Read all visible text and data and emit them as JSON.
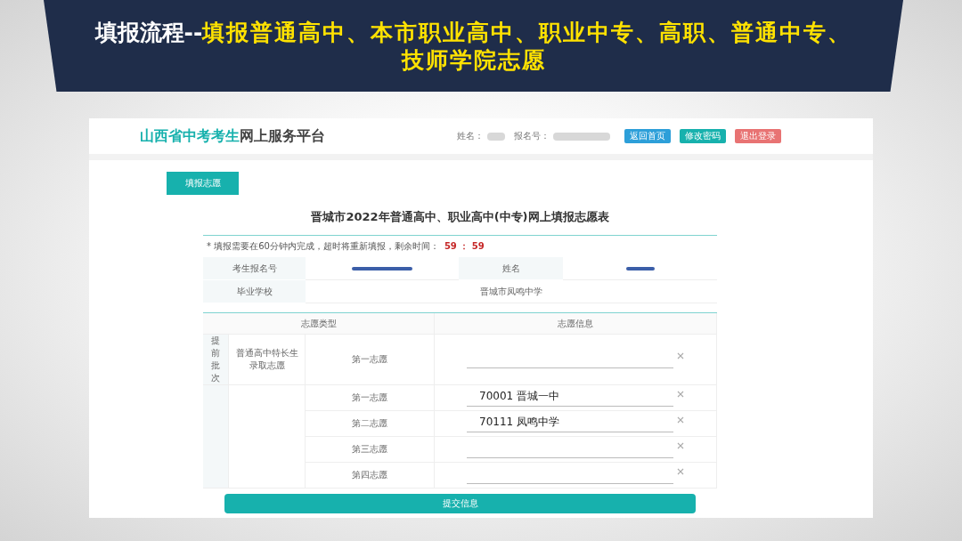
{
  "slide_title": {
    "lead": "填报流程--",
    "rest": "填报普通高中、本市职业高中、职业中专、高职、普通中专、技师学院志愿"
  },
  "header": {
    "brand_highlight": "山西省中考考生",
    "brand_rest": "网上服务平台",
    "name_label": "姓名：",
    "exam_no_label": "报名号：",
    "buttons": [
      {
        "label": "返回首页",
        "kind": "home"
      },
      {
        "label": "修改密码",
        "kind": "password"
      },
      {
        "label": "退出登录",
        "kind": "logout"
      }
    ]
  },
  "tab": {
    "label": "填报志愿",
    "selected": true
  },
  "form_title": "晋城市2022年普通高中、职业高中(中专)网上填报志愿表",
  "notice": {
    "mark": "*",
    "text": "填报需要在60分钟内完成，超时将重新填报，剩余时间：",
    "timer": "59 ： 59"
  },
  "student": [
    {
      "label": "考生报名号",
      "redacted": true
    },
    {
      "label": "姓名",
      "redacted": true
    },
    {
      "label": "毕业学校",
      "value": "晋城市凤鸣中学"
    }
  ],
  "choices": {
    "columns": [
      "志愿类型",
      "志愿信息"
    ],
    "groups": [
      {
        "batch": "提前批次",
        "type": "普通高中特长生录取志愿",
        "rows": [
          {
            "label": "第一志愿"
          }
        ]
      },
      {
        "rows": [
          {
            "label": "第一志愿",
            "value": "70001  晋城一中"
          },
          {
            "label": "第二志愿",
            "value": "70111  凤鸣中学"
          },
          {
            "label": "第三志愿"
          },
          {
            "label": "第四志愿"
          }
        ]
      }
    ]
  },
  "submit": "提交信息"
}
